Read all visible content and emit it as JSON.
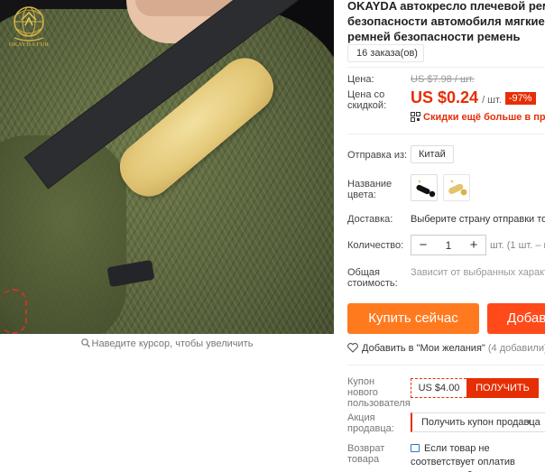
{
  "brand": {
    "logo_text": "OKAYDA FUR"
  },
  "image_area": {
    "zoom_hint": "Наведите курсор, чтобы увеличить"
  },
  "product": {
    "title_lines": [
      "OKAYDA автокресло плечевой ремень",
      "безопасности автомобиля мягкие Бес",
      "ремней безопасности ремень"
    ],
    "orders": "16 заказа(ов)"
  },
  "price": {
    "label": "Цена:",
    "old": "US $7.98 / шт.",
    "discount_label": "Цена со скидкой:",
    "current": "US $0.24",
    "unit": "/ шт.",
    "discount_badge": "-97%",
    "promo_link": "Скидки ещё больше в прило"
  },
  "shipping_from": {
    "label": "Отправка из:",
    "option": "Китай"
  },
  "color": {
    "label": "Название цвета:",
    "swatches": [
      "black-pad",
      "yellow-pad"
    ]
  },
  "delivery": {
    "label": "Доставка:",
    "value": "Выберите страну отправки това"
  },
  "quantity": {
    "label": "Количество:",
    "value": "1",
    "minus": "−",
    "plus": "+",
    "available": "шт. (1 шт. – м"
  },
  "total": {
    "label": "Общая стоимость:",
    "value": "Зависит от выбранных характер"
  },
  "actions": {
    "buy_now": "Купить сейчас",
    "add_to_cart": "Добавить"
  },
  "wishlist": {
    "label": "Добавить в \"Мои желания\"",
    "count": "(4 добавили)"
  },
  "coupon_new": {
    "label": "Купон нового пользователя",
    "amount": "US $4.00",
    "button": "ПОЛУЧИТЬ"
  },
  "seller_promo": {
    "label": "Акция продавца:",
    "select": "Получить купон продавца"
  },
  "returns": {
    "label": "Возврат товара",
    "text": "Если товар не соответствует оплатив стоимость обратно"
  },
  "colors": {
    "accent": "#e62e04",
    "buy": "#ff7a1f",
    "cart": "#ff4a1a",
    "logo_gold": "#d9b343"
  }
}
